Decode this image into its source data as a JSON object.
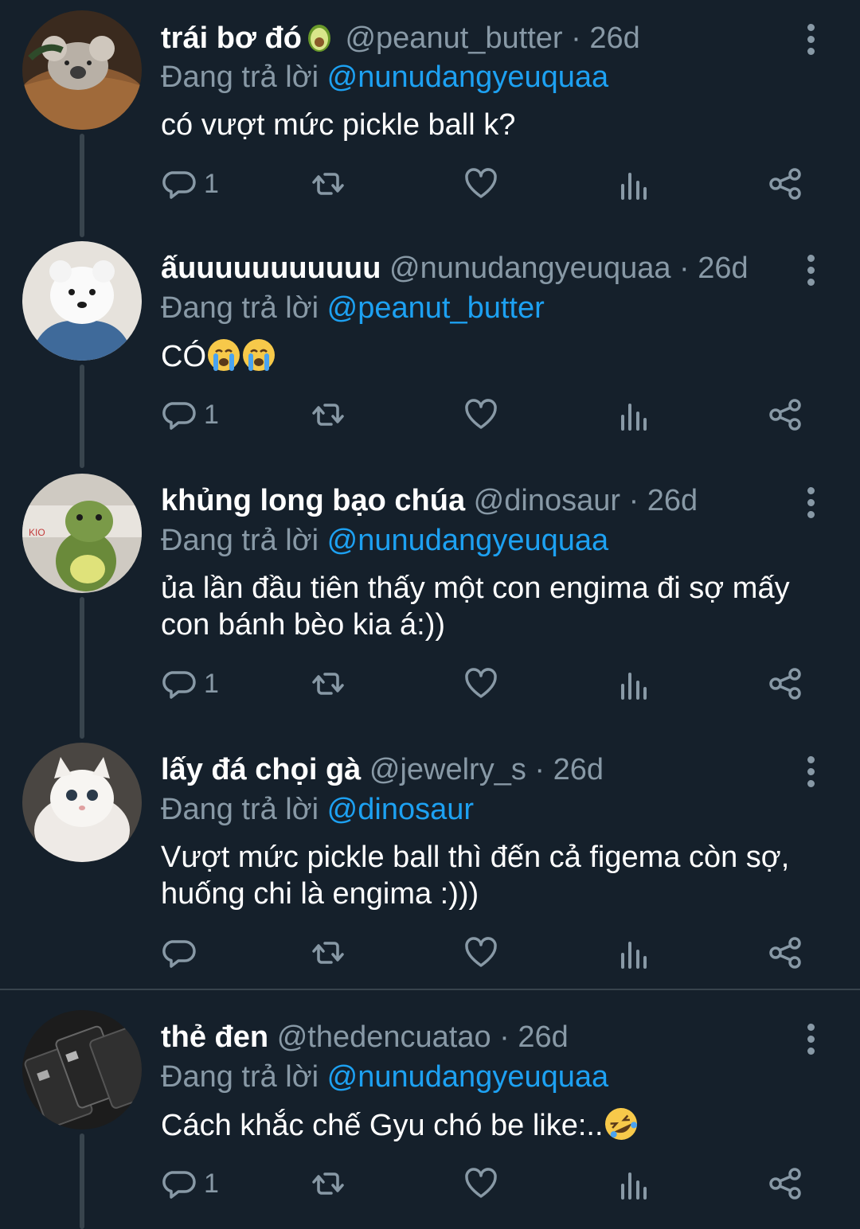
{
  "tweets": [
    {
      "name": "trái bơ đó",
      "handle": "@peanut_butter",
      "time": "· 26d",
      "reply_prefix": "Đang trả lời",
      "reply_to": "@nunudangyeuquaa",
      "text": "có vượt mức pickle ball k?",
      "reply_count": "1",
      "name_emoji": "avocado-emoji",
      "avatar": "koala-avatar"
    },
    {
      "name": "ấuuuuuuuuuuu",
      "handle": "@nunudangyeuquaa",
      "time": "· 26d",
      "reply_prefix": "Đang trả lời",
      "reply_to": "@peanut_butter",
      "text": "CÓ",
      "text_emoji": [
        "crying-face-emoji",
        "crying-face-emoji"
      ],
      "reply_count": "1",
      "avatar": "white-dog-avatar"
    },
    {
      "name": "khủng long bạo chúa",
      "handle": "@dinosaur",
      "time": "· 26d",
      "reply_prefix": "Đang trả lời",
      "reply_to": "@nunudangyeuquaa",
      "text": "ủa lần đầu tiên thấy một con engima đi sợ mấy con bánh bèo kia á:))",
      "reply_count": "1",
      "avatar": "dinosaur-plush-avatar"
    },
    {
      "name": "lấy đá chọi gà",
      "handle": "@jewelry_s",
      "time": "· 26d",
      "reply_prefix": "Đang trả lời",
      "reply_to": "@dinosaur",
      "text": "Vượt mức pickle ball thì đến cả figema còn sợ, huống chi là engima :)))",
      "reply_count": "",
      "avatar": "white-cat-avatar"
    },
    {
      "name": "thẻ đen",
      "handle": "@thedencuatao",
      "time": "· 26d",
      "reply_prefix": "Đang trả lời",
      "reply_to": "@nunudangyeuquaa",
      "text": "Cách khắc chế Gyu chó be like:..",
      "text_emoji": [
        "rolling-laughing-emoji"
      ],
      "reply_count": "1",
      "avatar": "black-cards-avatar"
    }
  ],
  "colors": {
    "background": "#15202b",
    "secondary_text": "#8899a6",
    "link": "#1da1f2",
    "divider": "#38444d"
  },
  "icons": [
    "reply-icon",
    "retweet-icon",
    "like-icon",
    "analytics-icon",
    "share-icon",
    "more-icon"
  ]
}
